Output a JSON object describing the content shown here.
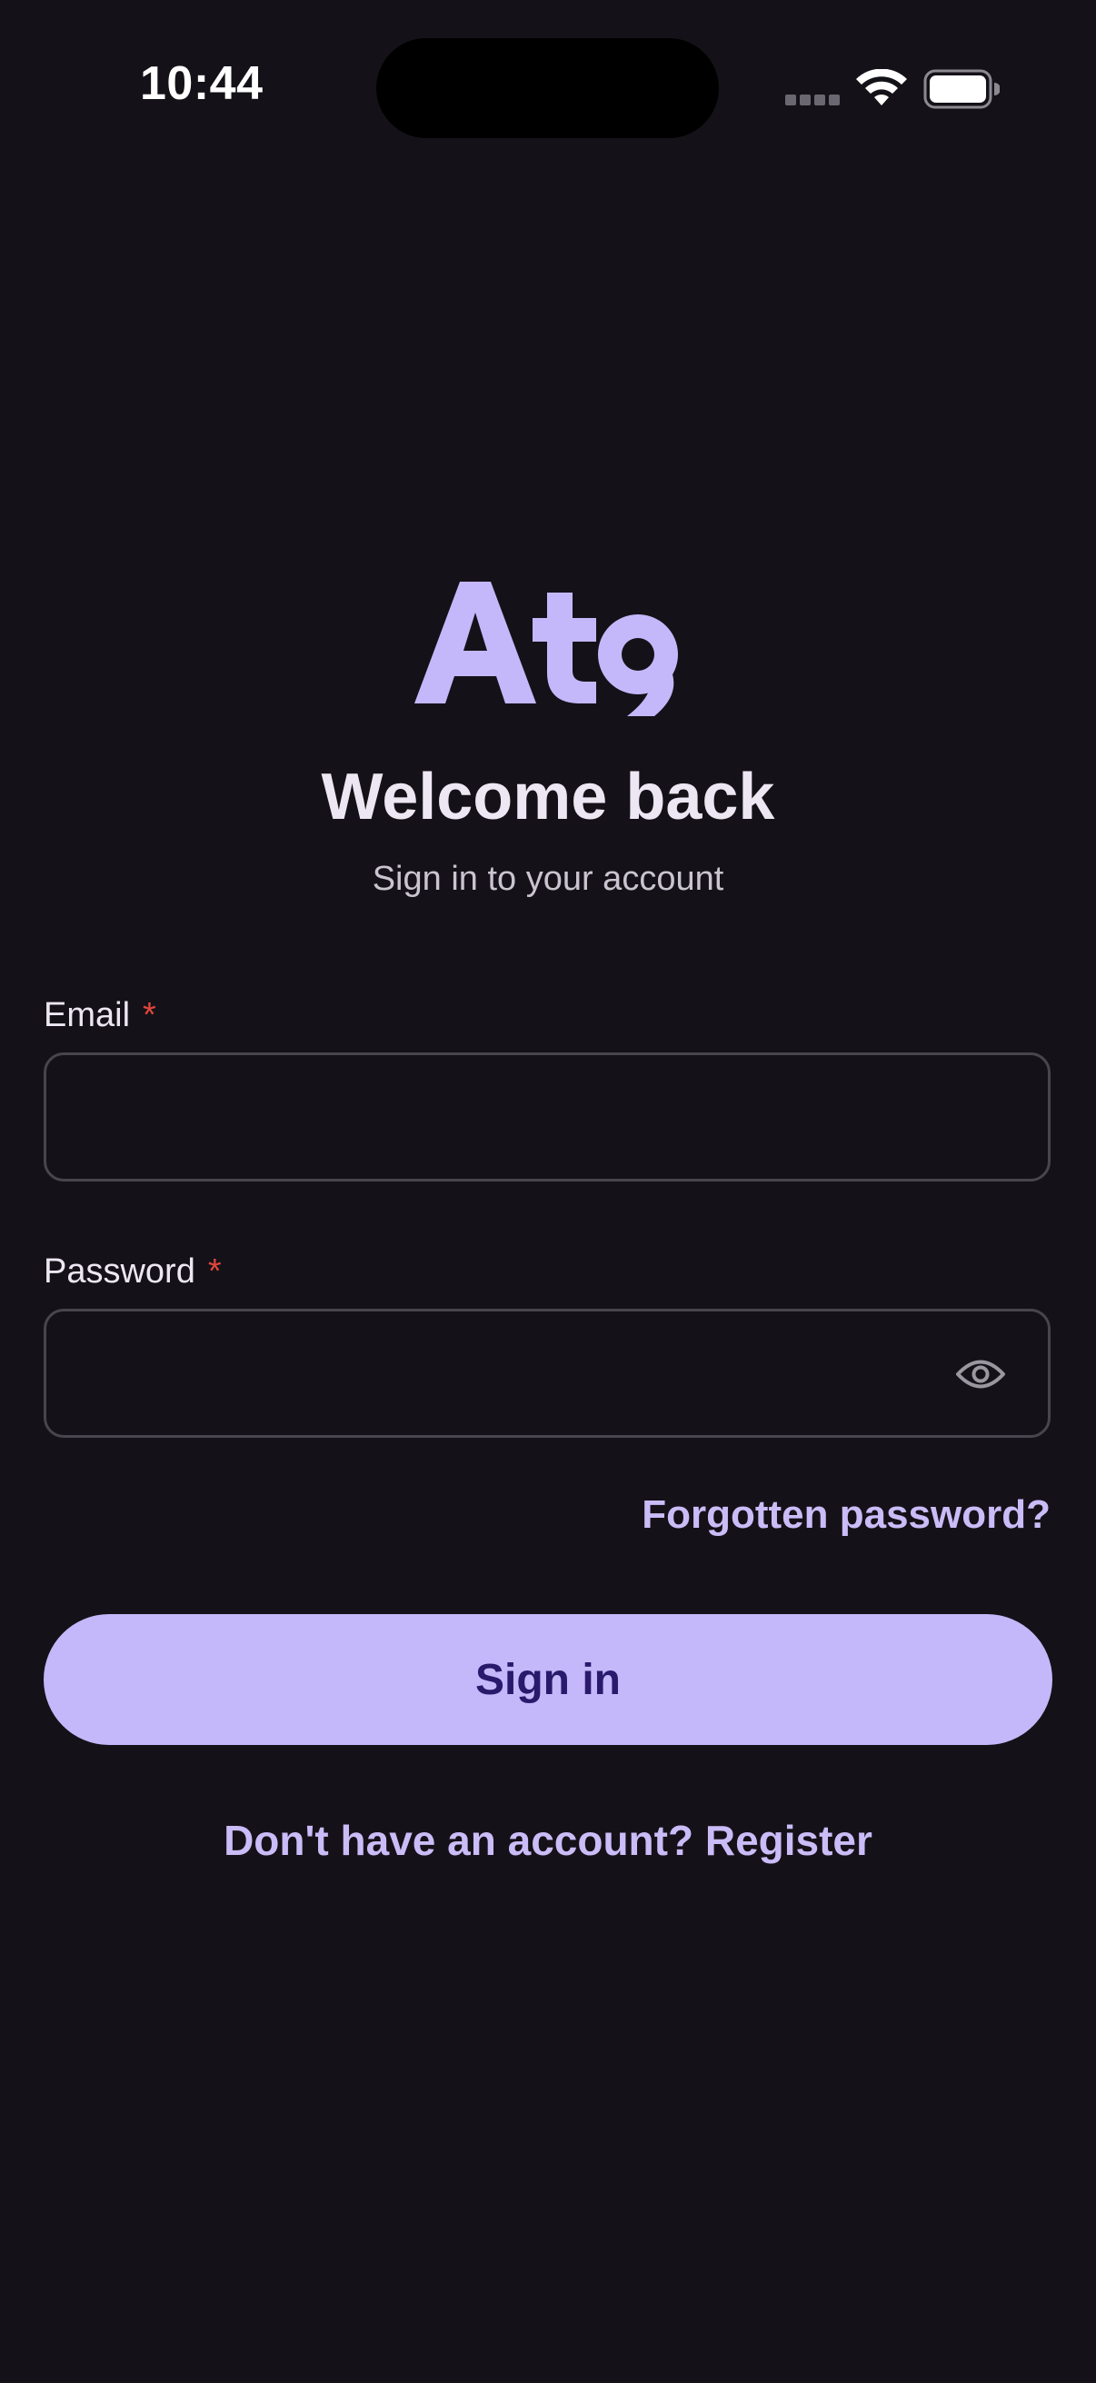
{
  "status_bar": {
    "time": "10:44",
    "icons": [
      "signal-icon",
      "wifi-icon",
      "battery-icon"
    ]
  },
  "brand": {
    "logo_text": "At9",
    "logo_color": "#c4b8fb"
  },
  "header": {
    "title": "Welcome back",
    "subtitle": "Sign in to your account"
  },
  "form": {
    "email": {
      "label": "Email",
      "required_mark": "*",
      "value": "",
      "placeholder": ""
    },
    "password": {
      "label": "Password",
      "required_mark": "*",
      "value": "",
      "placeholder": "",
      "toggle_icon": "eye-icon"
    },
    "forgot_password": "Forgotten password?",
    "submit_label": "Sign in",
    "register_prompt": "Don't have an account? Register"
  },
  "colors": {
    "background": "#141218",
    "accent": "#c4b8fb",
    "accent_text": "#2a1a6b",
    "link": "#c9bcf7",
    "required": "#e0463c",
    "field_border": "#48454e"
  }
}
